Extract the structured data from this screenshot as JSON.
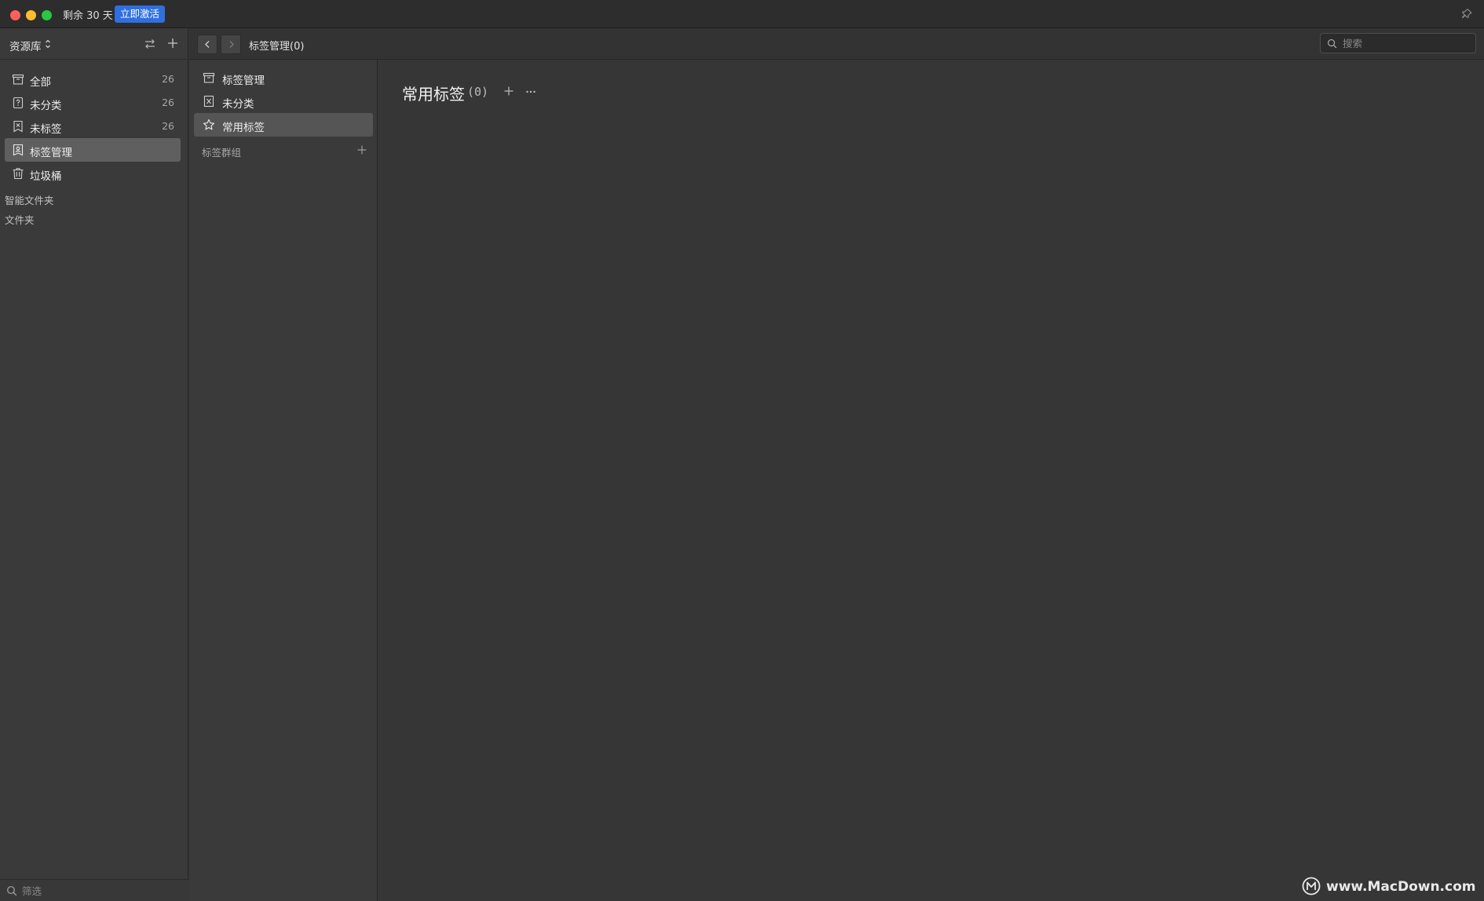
{
  "titlebar": {
    "trial_text": "剩余 30 天",
    "activate_label": "立即激活"
  },
  "sidebar": {
    "library_title": "资源库",
    "items": [
      {
        "label": "全部",
        "count": "26",
        "icon": "archive-box-icon"
      },
      {
        "label": "未分类",
        "count": "26",
        "icon": "unsorted-question-icon"
      },
      {
        "label": "未标签",
        "count": "26",
        "icon": "untagged-bookmark-icon"
      },
      {
        "label": "标签管理",
        "count": "",
        "icon": "tag-manage-icon",
        "active": true
      },
      {
        "label": "垃圾桶",
        "count": "",
        "icon": "trash-icon"
      }
    ],
    "sections": [
      "智能文件夹",
      "文件夹"
    ],
    "filter_placeholder": "筛选"
  },
  "toolbar": {
    "title": "标签管理(0)",
    "search_placeholder": "搜索"
  },
  "tag_panel": {
    "items": [
      {
        "label": "标签管理",
        "icon": "archive-box-icon"
      },
      {
        "label": "未分类",
        "icon": "unsorted-x-icon"
      },
      {
        "label": "常用标签",
        "icon": "star-icon",
        "active": true
      }
    ],
    "group_label": "标签群组"
  },
  "content": {
    "title": "常用标签",
    "count": "(0)"
  },
  "watermark": {
    "text": "www.MacDown.com"
  }
}
